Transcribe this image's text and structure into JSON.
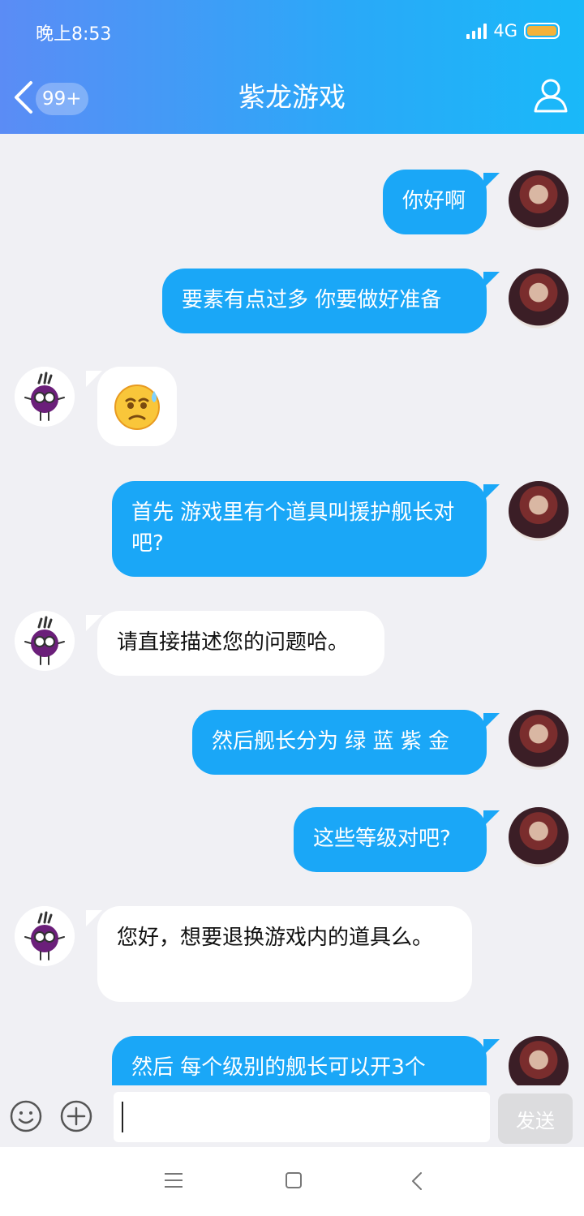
{
  "status_bar": {
    "time": "晚上8:53",
    "network": "4G"
  },
  "header": {
    "title": "紫龙游戏",
    "badge": "99+"
  },
  "messages": [
    {
      "side": "out",
      "text": "你好啊"
    },
    {
      "side": "out",
      "text": "要素有点过多 你要做好准备"
    },
    {
      "side": "in",
      "emoji": "sweat-face-emoji"
    },
    {
      "side": "out",
      "text": "首先 游戏里有个道具叫援护舰长对吧?"
    },
    {
      "side": "in",
      "text": "请直接描述您的问题哈。"
    },
    {
      "side": "out",
      "text": "然后舰长分为 绿 蓝 紫 金"
    },
    {
      "side": "out",
      "text": "这些等级对吧?"
    },
    {
      "side": "in",
      "text": "您好，想要退换游戏内的道具么。"
    },
    {
      "side": "out",
      "text": "然后 每个级别的舰长可以开3个"
    }
  ],
  "input": {
    "placeholder": "",
    "send_label": "发送"
  },
  "colors": {
    "header_start": "#5b8cf5",
    "header_end": "#19b9f9",
    "bubble_out": "#1aa7f7",
    "battery": "#f4b23a"
  }
}
